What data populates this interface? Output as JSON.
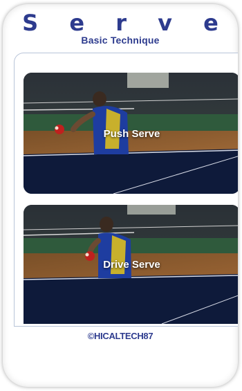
{
  "header": {
    "title": "S e r v e",
    "subtitle": "Basic Technique"
  },
  "cards": [
    {
      "label": "Push Serve",
      "image": "table-tennis-player-push-serve-photo"
    },
    {
      "label": "Drive Serve",
      "image": "table-tennis-player-drive-serve-photo"
    }
  ],
  "footer": {
    "credit": "©HICALTECH87"
  },
  "colors": {
    "title": "#2d3b8e",
    "panel_border": "#b8c4d8",
    "floor": "#8a5a30",
    "table": "#0e1a3a"
  }
}
